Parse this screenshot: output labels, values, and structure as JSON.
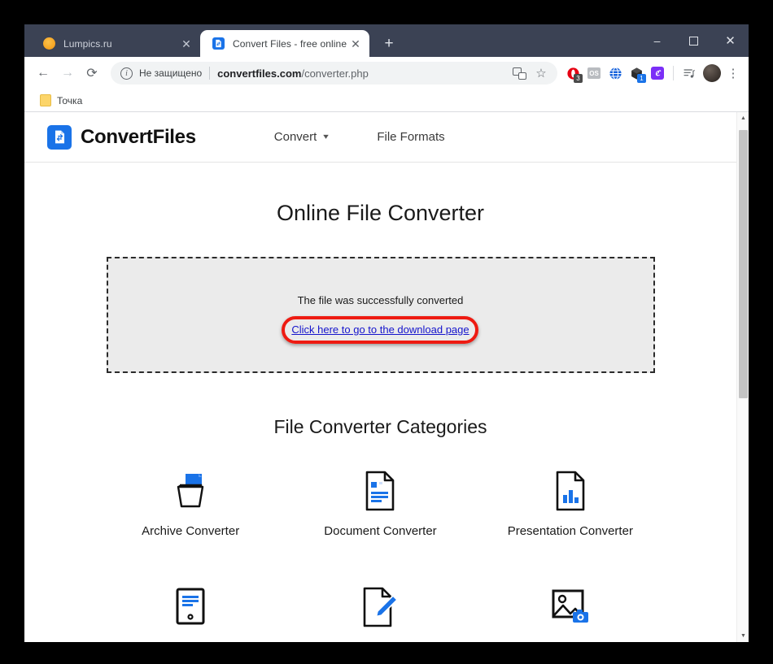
{
  "browser": {
    "tabs": [
      {
        "title": "Lumpics.ru",
        "favicon": "orange-circle-icon",
        "active": false
      },
      {
        "title": "Convert Files - free online file co",
        "favicon": "convertfiles-icon",
        "active": true
      }
    ],
    "new_tab_label": "+",
    "window_controls": {
      "minimize": "–",
      "maximize": "□",
      "close": "✕"
    },
    "nav": {
      "back": "←",
      "forward": "→",
      "reload": "⟳"
    },
    "omnibox": {
      "security_label": "Не защищено",
      "url_domain": "convertfiles.com",
      "url_path": "/converter.php",
      "info_icon": "i"
    },
    "extensions": [
      {
        "name": "opera-extension-icon",
        "badge": "3"
      },
      {
        "name": "os-extension-icon",
        "badge": ""
      },
      {
        "name": "globe-extension-icon",
        "badge": ""
      },
      {
        "name": "box-extension-icon",
        "badge": "1"
      },
      {
        "name": "purple-extension-icon",
        "badge": ""
      }
    ],
    "bookmarks": [
      {
        "label": "Точка",
        "icon": "folder-icon"
      }
    ]
  },
  "site": {
    "logo_text": "ConvertFiles",
    "nav": [
      {
        "label": "Convert",
        "has_caret": true
      },
      {
        "label": "File Formats",
        "has_caret": false
      }
    ],
    "page_title": "Online File Converter",
    "result": {
      "message": "The file was successfully converted",
      "link_label": "Click here to go to the download page",
      "highlight_color": "#ee1b12"
    },
    "categories_title": "File Converter Categories",
    "categories": [
      {
        "label": "Archive Converter",
        "icon": "archive-box-icon"
      },
      {
        "label": "Document Converter",
        "icon": "document-page-icon"
      },
      {
        "label": "Presentation Converter",
        "icon": "presentation-chart-icon"
      },
      {
        "label": "",
        "icon": "ebook-reader-icon"
      },
      {
        "label": "",
        "icon": "document-pencil-icon"
      },
      {
        "label": "",
        "icon": "image-camera-icon"
      }
    ],
    "accent_color": "#1a73e8"
  }
}
